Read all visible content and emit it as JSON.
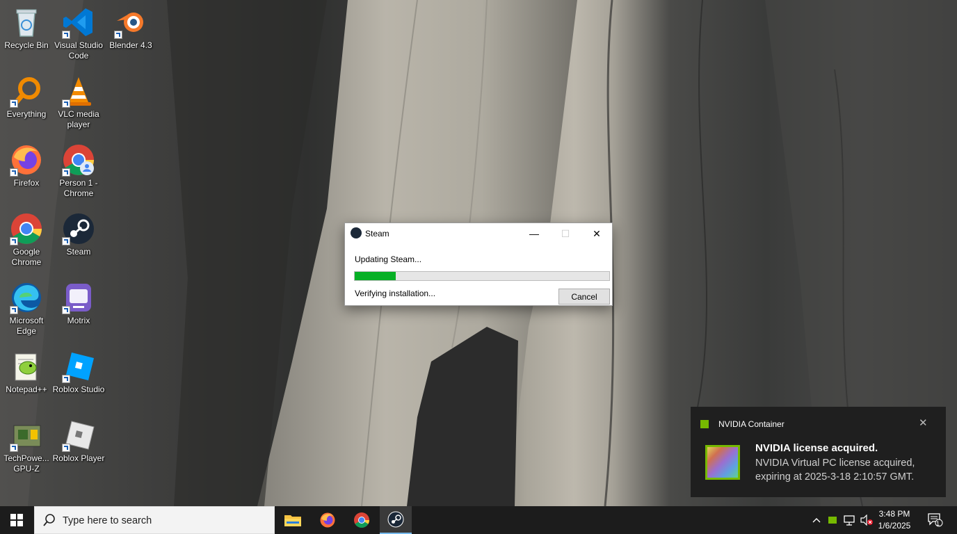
{
  "desktop_icons": [
    {
      "label": "Recycle Bin",
      "icon": "recycle-bin-icon"
    },
    {
      "label": "Visual Studio Code",
      "icon": "vscode-icon"
    },
    {
      "label": "Blender 4.3",
      "icon": "blender-icon"
    },
    {
      "label": "Everything",
      "icon": "everything-search-icon"
    },
    {
      "label": "VLC media player",
      "icon": "vlc-icon"
    },
    {
      "label": "Firefox",
      "icon": "firefox-icon"
    },
    {
      "label": "Person 1 - Chrome",
      "icon": "chrome-profile-icon"
    },
    {
      "label": "Google Chrome",
      "icon": "chrome-icon"
    },
    {
      "label": "Steam",
      "icon": "steam-icon"
    },
    {
      "label": "Microsoft Edge",
      "icon": "edge-icon"
    },
    {
      "label": "Motrix",
      "icon": "motrix-icon"
    },
    {
      "label": "Notepad++",
      "icon": "notepadpp-icon"
    },
    {
      "label": "Roblox Studio",
      "icon": "roblox-studio-icon"
    },
    {
      "label": "TechPowerUp GPU-Z",
      "display_label": "TechPowe... GPU-Z",
      "icon": "gpuz-icon"
    },
    {
      "label": "Roblox Player",
      "icon": "roblox-player-icon"
    }
  ],
  "steam_dialog": {
    "title": "Steam",
    "message": "Updating Steam...",
    "progress": 0.16,
    "status": "Verifying installation...",
    "cancel_label": "Cancel",
    "minimize_glyph": "—",
    "maximize_glyph": "☐",
    "close_glyph": "✕"
  },
  "notification": {
    "app_name": "NVIDIA Container",
    "title": "NVIDIA license acquired.",
    "body": "NVIDIA Virtual PC license acquired, expiring at 2025-3-18 2:10:57 GMT.",
    "close_glyph": "✕",
    "accent": "#76b900"
  },
  "taskbar": {
    "search_placeholder": "Type here to search",
    "pinned_apps": [
      "file-explorer-icon",
      "firefox-icon",
      "chrome-icon",
      "steam-icon"
    ],
    "active_app": "steam-icon",
    "clock": {
      "time": "3:48 PM",
      "date": "1/6/2025"
    },
    "notification_count": "1",
    "tray_chevron": "^"
  },
  "colors": {
    "progress_fill": "#06b025",
    "taskbar_bg": "#1c1c1c",
    "toast_bg": "#1f1f1f"
  }
}
